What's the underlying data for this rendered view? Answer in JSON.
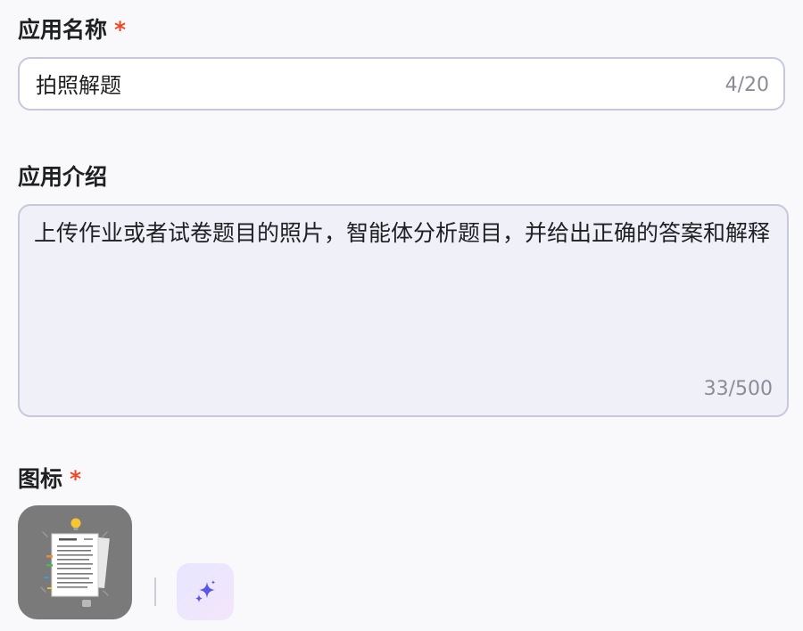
{
  "fields": {
    "name": {
      "label": "应用名称",
      "required_mark": "*",
      "value": "拍照解题",
      "counter": "4/20"
    },
    "description": {
      "label": "应用介绍",
      "value": "上传作业或者试卷题目的照片，智能体分析题目，并给出正确的答案和解释",
      "counter": "33/500"
    },
    "icon": {
      "label": "图标",
      "required_mark": "*"
    }
  },
  "colors": {
    "required": "#ef4623",
    "ai_accent": "#5b57e6",
    "thumb_background": "#7a7a7a"
  },
  "icons": {
    "app_icon": "document-checklist-with-lightbulb-icon",
    "ai_generate": "sparkles-icon"
  }
}
